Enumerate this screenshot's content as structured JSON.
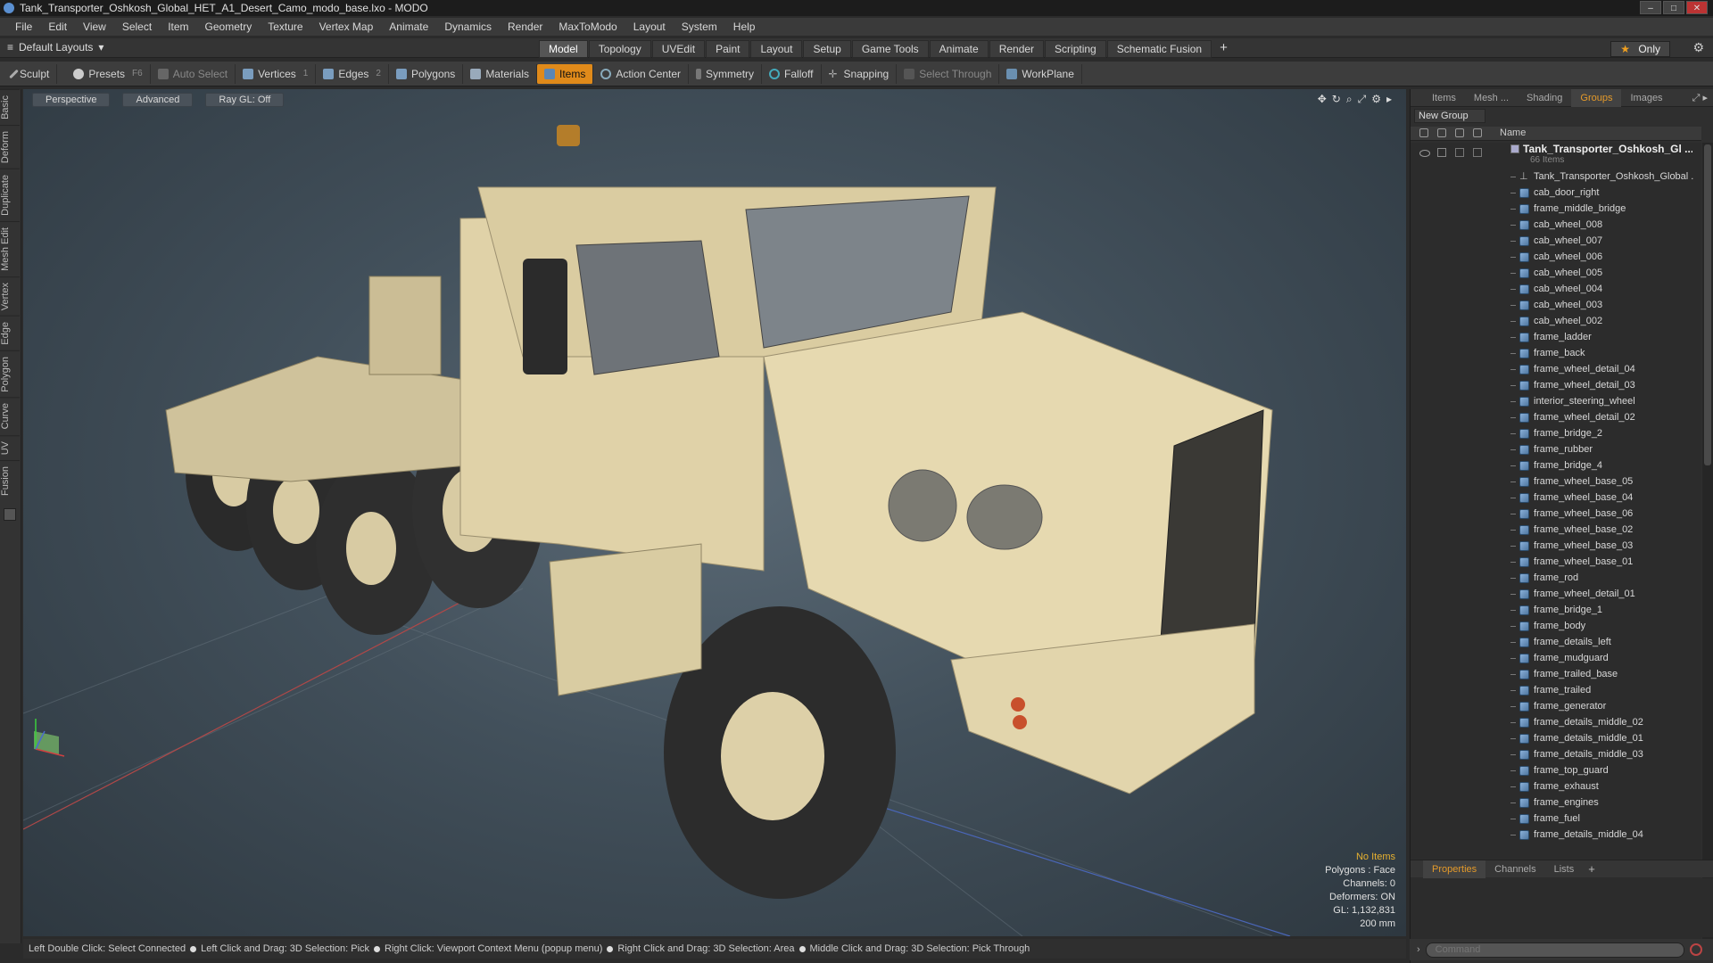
{
  "window": {
    "title": "Tank_Transporter_Oshkosh_Global_HET_A1_Desert_Camo_modo_base.lxo - MODO"
  },
  "menu": [
    "File",
    "Edit",
    "View",
    "Select",
    "Item",
    "Geometry",
    "Texture",
    "Vertex Map",
    "Animate",
    "Dynamics",
    "Render",
    "MaxToModo",
    "Layout",
    "System",
    "Help"
  ],
  "layouts": {
    "current": "Default Layouts",
    "tabs": [
      "Model",
      "Topology",
      "UVEdit",
      "Paint",
      "Layout",
      "Setup",
      "Game Tools",
      "Animate",
      "Render",
      "Scripting",
      "Schematic Fusion"
    ],
    "active_tab": "Model",
    "only_label": "Only"
  },
  "toolbar": {
    "sculpt": "Sculpt",
    "presets": "Presets",
    "presets_shortcut": "F6",
    "auto_select": "Auto Select",
    "vertices": "Vertices",
    "vertices_num": "1",
    "edges": "Edges",
    "edges_num": "2",
    "polygons": "Polygons",
    "materials": "Materials",
    "items": "Items",
    "action_center": "Action Center",
    "symmetry": "Symmetry",
    "falloff": "Falloff",
    "snapping": "Snapping",
    "select_through": "Select Through",
    "workplane": "WorkPlane"
  },
  "left_tabs": [
    "Basic",
    "Deform",
    "Duplicate",
    "Mesh Edit",
    "Vertex",
    "Edge",
    "Polygon",
    "Curve",
    "UV",
    "Fusion"
  ],
  "viewport": {
    "view": "Perspective",
    "shading": "Advanced",
    "raygl": "Ray GL: Off",
    "info": {
      "no_items": "No Items",
      "polygons": "Polygons : Face",
      "channels": "Channels: 0",
      "deformers": "Deformers: ON",
      "gl": "GL: 1,132,831",
      "scale": "200 mm"
    }
  },
  "status_bar": [
    "Left Double Click: Select Connected",
    "Left Click and Drag: 3D Selection: Pick",
    "Right Click: Viewport Context Menu (popup menu)",
    "Right Click and Drag: 3D Selection: Area",
    "Middle Click and Drag: 3D Selection: Pick Through"
  ],
  "right_panel": {
    "tabs": [
      "Items",
      "Mesh ...",
      "Shading",
      "Groups",
      "Images"
    ],
    "active_tab": "Groups",
    "new_group": "New Group",
    "column_name": "Name",
    "group_name": "Tank_Transporter_Oshkosh_Gl ...",
    "group_count": "66 Items",
    "items": [
      "Tank_Transporter_Oshkosh_Global ...",
      "cab_door_right",
      "frame_middle_bridge",
      "cab_wheel_008",
      "cab_wheel_007",
      "cab_wheel_006",
      "cab_wheel_005",
      "cab_wheel_004",
      "cab_wheel_003",
      "cab_wheel_002",
      "frame_ladder",
      "frame_back",
      "frame_wheel_detail_04",
      "frame_wheel_detail_03",
      "interior_steering_wheel",
      "frame_wheel_detail_02",
      "frame_bridge_2",
      "frame_rubber",
      "frame_bridge_4",
      "frame_wheel_base_05",
      "frame_wheel_base_04",
      "frame_wheel_base_06",
      "frame_wheel_base_02",
      "frame_wheel_base_03",
      "frame_wheel_base_01",
      "frame_rod",
      "frame_wheel_detail_01",
      "frame_bridge_1",
      "frame_body",
      "frame_details_left",
      "frame_mudguard",
      "frame_trailed_base",
      "frame_trailed",
      "frame_generator",
      "frame_details_middle_02",
      "frame_details_middle_01",
      "frame_details_middle_03",
      "frame_top_guard",
      "frame_exhaust",
      "frame_engines",
      "frame_fuel",
      "frame_details_middle_04"
    ],
    "props_tabs": [
      "Properties",
      "Channels",
      "Lists"
    ],
    "props_active": "Properties",
    "command_placeholder": "Command"
  },
  "colors": {
    "accent": "#e08a1a",
    "model_body": "#dccfa6",
    "tire": "#2c2c2c",
    "viewport_bg": "#4a5762"
  }
}
